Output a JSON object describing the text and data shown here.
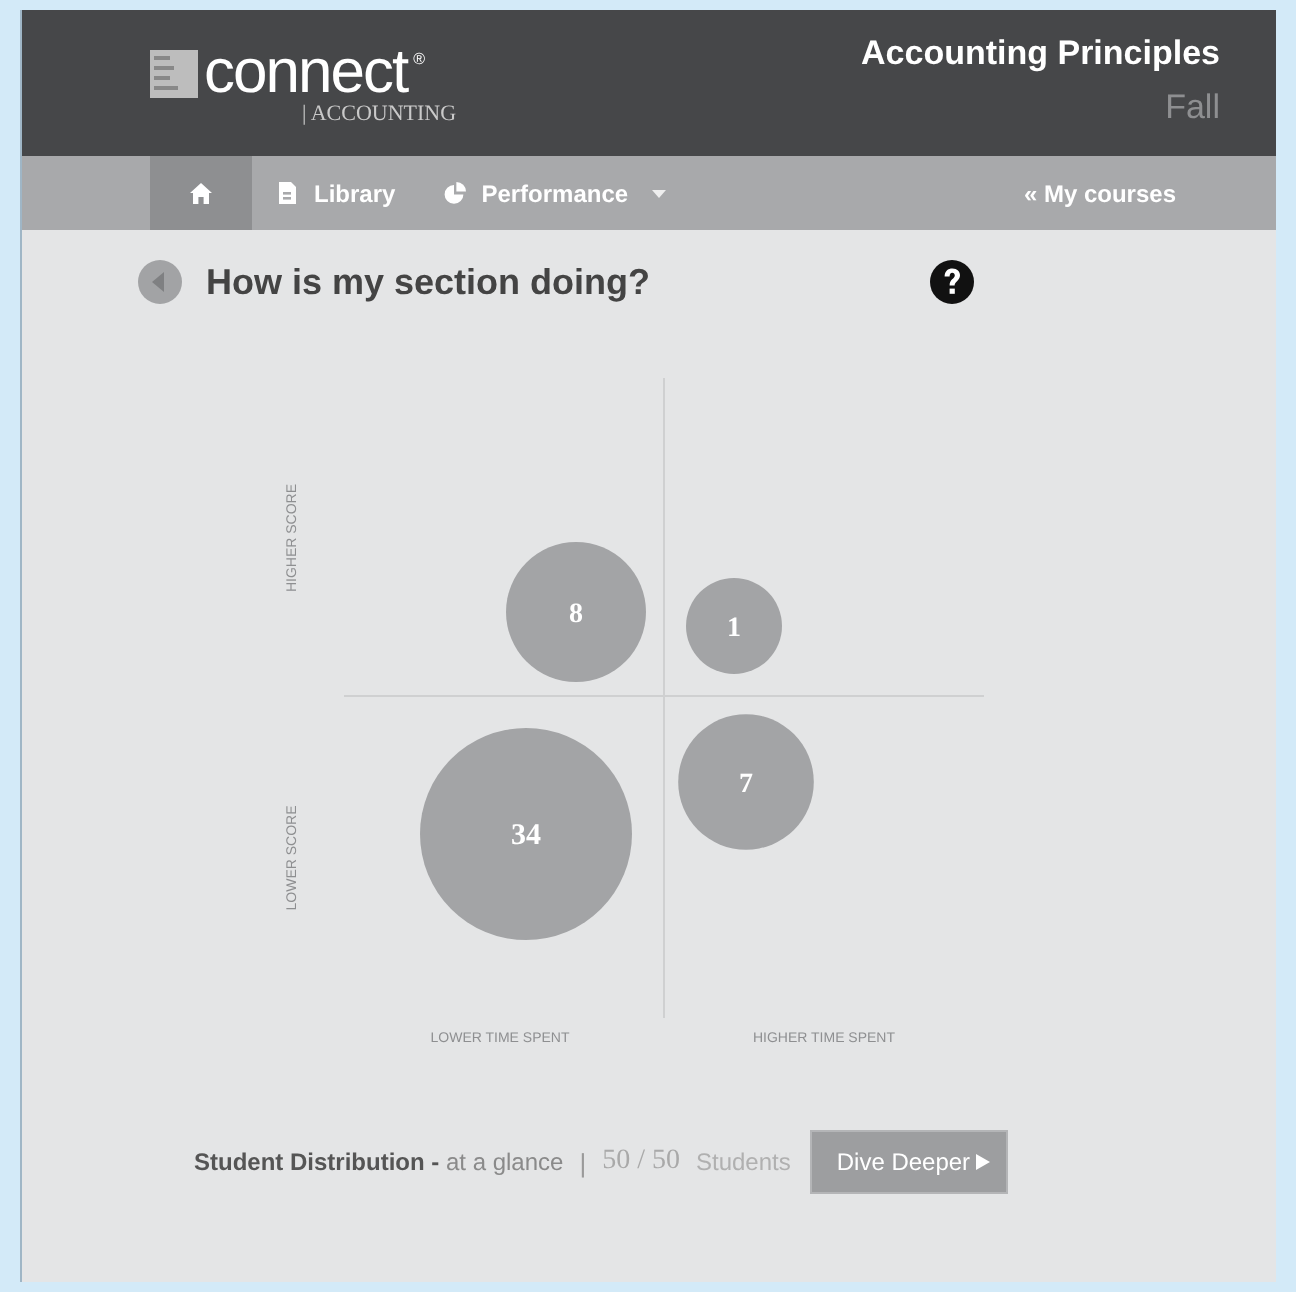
{
  "header": {
    "logo": {
      "brand": "connect",
      "mark": "®",
      "subject": "| ACCOUNTING"
    },
    "course": {
      "title": "Accounting Principles",
      "term": "Fall"
    }
  },
  "nav": {
    "items": [
      {
        "kind": "home",
        "selected": true
      },
      {
        "kind": "library",
        "label": "Library",
        "selected": false
      },
      {
        "kind": "performance",
        "label": "Performance",
        "selected": false,
        "dropdown": true
      }
    ],
    "back_link": "« My courses"
  },
  "page": {
    "title": "How is my section doing?"
  },
  "chart": {
    "y_axis_labels": [
      "HIGHER SCORE",
      "LOWER SCORE"
    ],
    "x_axis_labels": [
      "LOWER TIME SPENT",
      "HIGHER TIME SPENT"
    ],
    "bubbles": [
      {
        "count": "8"
      },
      {
        "count": "1"
      },
      {
        "count": "34"
      },
      {
        "count": "7"
      }
    ]
  },
  "footer": {
    "summary": "**Student Distribution -** at a glance",
    "separator": "|",
    "count": "50 / 50",
    "unit": "Students",
    "button": "Dive Deeper"
  }
}
